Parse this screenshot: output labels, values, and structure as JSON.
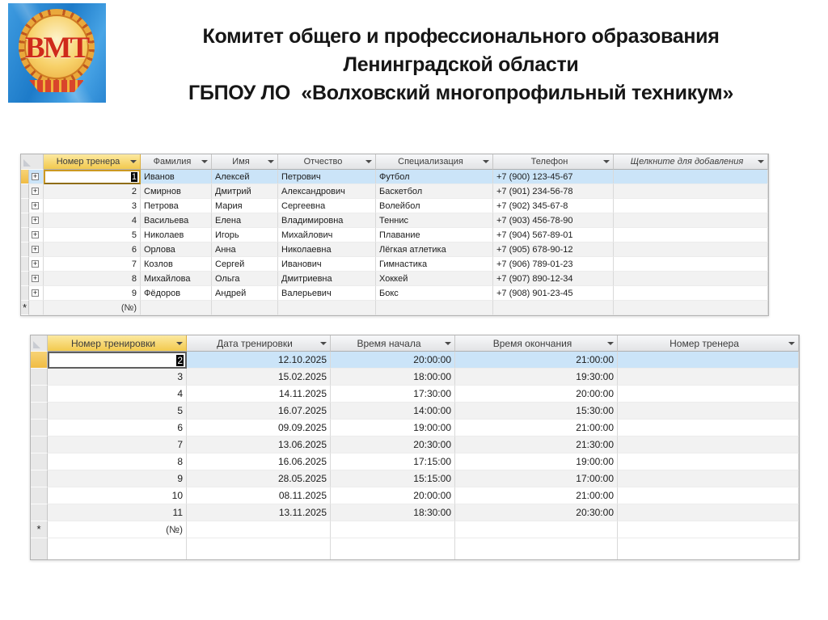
{
  "slide": {
    "title_lines": [
      "Комитет общего и профессионального образования",
      "Ленинградской области",
      "ГБПОУ ЛО  «Волховский многопрофильный техникум»"
    ],
    "logo": {
      "text": "ВМТ"
    }
  },
  "trainers_table": {
    "columns": [
      "Номер тренера",
      "Фамилия",
      "Имя",
      "Отчество",
      "Специализация",
      "Телефон",
      "Щелкните для добавления"
    ],
    "rows": [
      [
        "1",
        "Иванов",
        "Алексей",
        "Петрович",
        "Футбол",
        "+7 (900) 123-45-67",
        ""
      ],
      [
        "2",
        "Смирнов",
        "Дмитрий",
        "Александрович",
        "Баскетбол",
        "+7 (901) 234-56-78",
        ""
      ],
      [
        "3",
        "Петрова",
        "Мария",
        "Сергеевна",
        "Волейбол",
        "+7 (902) 345-67-8",
        ""
      ],
      [
        "4",
        "Васильева",
        "Елена",
        "Владимировна",
        "Теннис",
        "+7 (903) 456-78-90",
        ""
      ],
      [
        "5",
        "Николаев",
        "Игорь",
        "Михайлович",
        "Плавание",
        "+7 (904) 567-89-01",
        ""
      ],
      [
        "6",
        "Орлова",
        "Анна",
        "Николаевна",
        "Лёгкая атлетика",
        "+7 (905) 678-90-12",
        ""
      ],
      [
        "7",
        "Козлов",
        "Сергей",
        "Иванович",
        "Гимнастика",
        "+7 (906) 789-01-23",
        ""
      ],
      [
        "8",
        "Михайлова",
        "Ольга",
        "Дмитриевна",
        "Хоккей",
        "+7 (907) 890-12-34",
        ""
      ],
      [
        "9",
        "Фёдоров",
        "Андрей",
        "Валерьевич",
        "Бокс",
        "+7 (908) 901-23-45",
        ""
      ]
    ],
    "new_row_label": "(№)",
    "new_row_marker": "*"
  },
  "trainings_table": {
    "columns": [
      "Номер тренировки",
      "Дата тренировки",
      "Время начала",
      "Время окончания",
      "Номер тренера"
    ],
    "rows": [
      [
        "2",
        "12.10.2025",
        "20:00:00",
        "21:00:00",
        ""
      ],
      [
        "3",
        "15.02.2025",
        "18:00:00",
        "19:30:00",
        ""
      ],
      [
        "4",
        "14.11.2025",
        "17:30:00",
        "20:00:00",
        ""
      ],
      [
        "5",
        "16.07.2025",
        "14:00:00",
        "15:30:00",
        ""
      ],
      [
        "6",
        "09.09.2025",
        "19:00:00",
        "21:00:00",
        ""
      ],
      [
        "7",
        "13.06.2025",
        "20:30:00",
        "21:30:00",
        ""
      ],
      [
        "8",
        "16.06.2025",
        "17:15:00",
        "19:00:00",
        ""
      ],
      [
        "9",
        "28.05.2025",
        "15:15:00",
        "17:00:00",
        ""
      ],
      [
        "10",
        "08.11.2025",
        "20:00:00",
        "21:00:00",
        ""
      ],
      [
        "11",
        "13.11.2025",
        "18:30:00",
        "20:30:00",
        ""
      ]
    ],
    "new_row_label": "(№)",
    "new_row_marker": "*"
  },
  "colors": {
    "accent_amber": "#f2c94e",
    "selected_row_blue": "#cbe4f8",
    "header_gray": "#e2e3e5",
    "logo_blue": "#2a86d2",
    "logo_red": "#cf2a1b"
  }
}
